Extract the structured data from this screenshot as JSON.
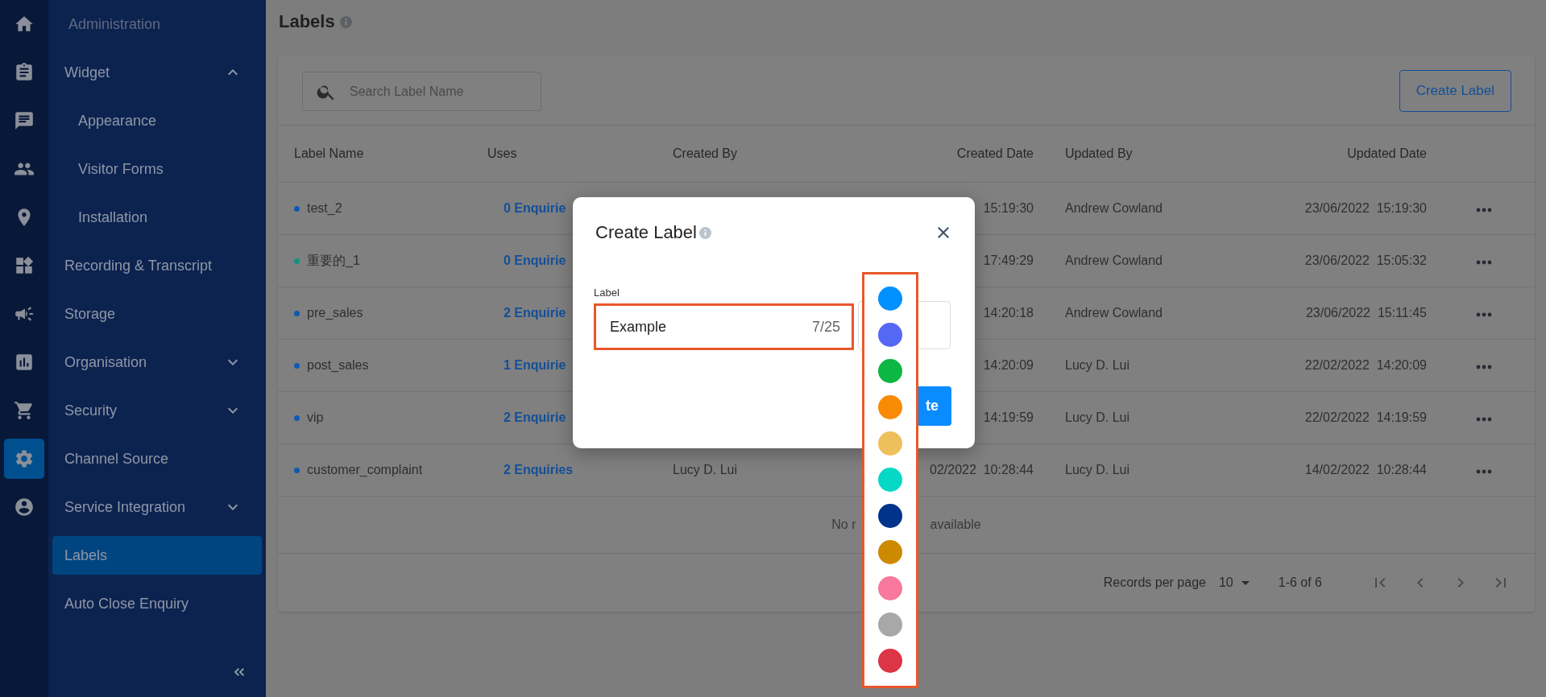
{
  "rail": [
    {
      "selected": false
    },
    {
      "selected": false
    },
    {
      "selected": false
    },
    {
      "selected": false
    },
    {
      "selected": false
    },
    {
      "selected": false
    },
    {
      "selected": false
    },
    {
      "selected": false
    },
    {
      "selected": false
    },
    {
      "selected": true
    },
    {
      "selected": false
    }
  ],
  "sidebar": {
    "heading": "Administration",
    "items": [
      {
        "label": "Widget",
        "expanded": true,
        "selected": false,
        "children": [
          {
            "label": "Appearance",
            "selected": false
          },
          {
            "label": "Visitor Forms",
            "selected": false
          },
          {
            "label": "Installation",
            "selected": false
          }
        ]
      },
      {
        "label": "Recording & Transcript",
        "selected": false
      },
      {
        "label": "Storage",
        "selected": false
      },
      {
        "label": "Organisation",
        "expanded": false,
        "selected": false
      },
      {
        "label": "Security",
        "expanded": false,
        "selected": false
      },
      {
        "label": "Channel Source",
        "selected": false
      },
      {
        "label": "Service Integration",
        "expanded": false,
        "selected": false
      },
      {
        "label": "Labels",
        "selected": true
      },
      {
        "label": "Auto Close Enquiry",
        "selected": false
      }
    ]
  },
  "page": {
    "title": "Labels",
    "search_placeholder": "Search Label Name",
    "create_button": "Create Label",
    "columns": [
      "Label Name",
      "Uses",
      "Created By",
      "Created Date",
      "Updated By",
      "Updated Date"
    ],
    "rows": [
      {
        "name": "test_2",
        "color": "#0d5bb0",
        "uses": "0 Enquirie",
        "created_date": "15:19:30",
        "updated_by": "Andrew Cowland",
        "updated_date": "23/06/2022  15:19:30"
      },
      {
        "name": "重要的_1",
        "color": "#12907e",
        "uses": "0 Enquirie",
        "created_date": "17:49:29",
        "updated_by": "Andrew Cowland",
        "updated_date": "23/06/2022  15:05:32"
      },
      {
        "name": "pre_sales",
        "color": "#0d5bb0",
        "uses": "2 Enquirie",
        "created_date": "14:20:18",
        "updated_by": "Andrew Cowland",
        "updated_date": "23/06/2022  15:11:45"
      },
      {
        "name": "post_sales",
        "color": "#0d5bb0",
        "uses": "1 Enquirie",
        "created_date": "14:20:09",
        "updated_by": "Lucy D. Lui",
        "updated_date": "22/02/2022  14:20:09"
      },
      {
        "name": "vip",
        "color": "#0d5bb0",
        "uses": "2 Enquirie",
        "created_date": "14:19:59",
        "updated_by": "Lucy D. Lui",
        "updated_date": "22/02/2022  14:19:59"
      },
      {
        "name": "customer_complaint",
        "color": "#0d5bb0",
        "uses": "2 Enquiries",
        "created_by": "Lucy D. Lui",
        "created_date": "02/2022  10:28:44",
        "updated_by": "Lucy D. Lui",
        "updated_date": "14/02/2022  10:28:44"
      }
    ],
    "empty_text": [
      "No r",
      "available"
    ],
    "pagination": {
      "label": "Records per page",
      "per_page": "10",
      "range": "1-6 of 6"
    }
  },
  "modal": {
    "title": "Create Label",
    "field_label": "Label",
    "value": "Example",
    "counter": "7/25",
    "button": "te"
  },
  "color_picker": [
    {
      "color": "#0090ff"
    },
    {
      "color": "#5468f5"
    },
    {
      "color": "#0cb744"
    },
    {
      "color": "#f98a04"
    },
    {
      "color": "#eec05b"
    },
    {
      "color": "#06d8c6"
    },
    {
      "color": "#00338a"
    },
    {
      "color": "#cc8a00"
    },
    {
      "color": "#f8799b"
    },
    {
      "color": "#a8a8a8"
    },
    {
      "color": "#dc3545"
    }
  ]
}
